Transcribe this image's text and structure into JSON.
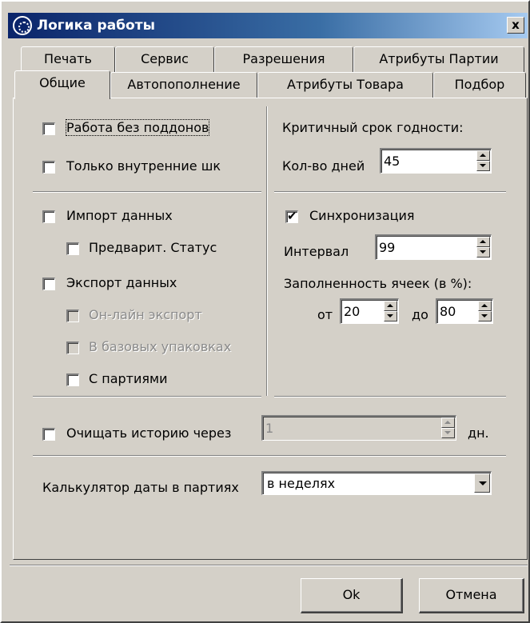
{
  "window": {
    "title": "Логика работы",
    "close_label": "x"
  },
  "tabs_row1": [
    {
      "label": "Печать"
    },
    {
      "label": "Сервис"
    },
    {
      "label": "Разрешения"
    },
    {
      "label": "Атрибуты Партии"
    }
  ],
  "tabs_row2": [
    {
      "label": "Общие",
      "active": true
    },
    {
      "label": "Автопополнение"
    },
    {
      "label": "Атрибуты Товара"
    },
    {
      "label": "Подбор"
    }
  ],
  "left": {
    "no_pallets": {
      "label": "Работа без поддонов",
      "checked": false
    },
    "internal_barcodes": {
      "label": "Только внутренние шк",
      "checked": false
    },
    "import": {
      "label": "Импорт данных",
      "checked": false
    },
    "prelim_status": {
      "label": "Предварит. Статус",
      "checked": false
    },
    "export": {
      "label": "Экспорт данных",
      "checked": false
    },
    "online_export": {
      "label": "Он-лайн экспорт",
      "checked": false,
      "disabled": true
    },
    "base_packs": {
      "label": "В базовых упаковках",
      "checked": false,
      "disabled": true
    },
    "with_batches": {
      "label": "С партиями",
      "checked": false
    }
  },
  "right": {
    "critical_title": "Критичный срок годности:",
    "days_label": "Кол-во дней",
    "days_value": "45",
    "sync": {
      "label": "Синхронизация",
      "checked": true
    },
    "interval_label": "Интервал",
    "interval_value": "99",
    "fill_title": "Заполненность ячеек (в %):",
    "from_label": "от",
    "from_value": "20",
    "to_label": "до",
    "to_value": "80"
  },
  "history": {
    "label": "Очищать историю через",
    "checked": false,
    "value": "1",
    "unit": "дн."
  },
  "calc": {
    "label": "Калькулятор даты в партиях",
    "selected": "в неделях"
  },
  "buttons": {
    "ok": "Ok",
    "cancel": "Отмена"
  }
}
